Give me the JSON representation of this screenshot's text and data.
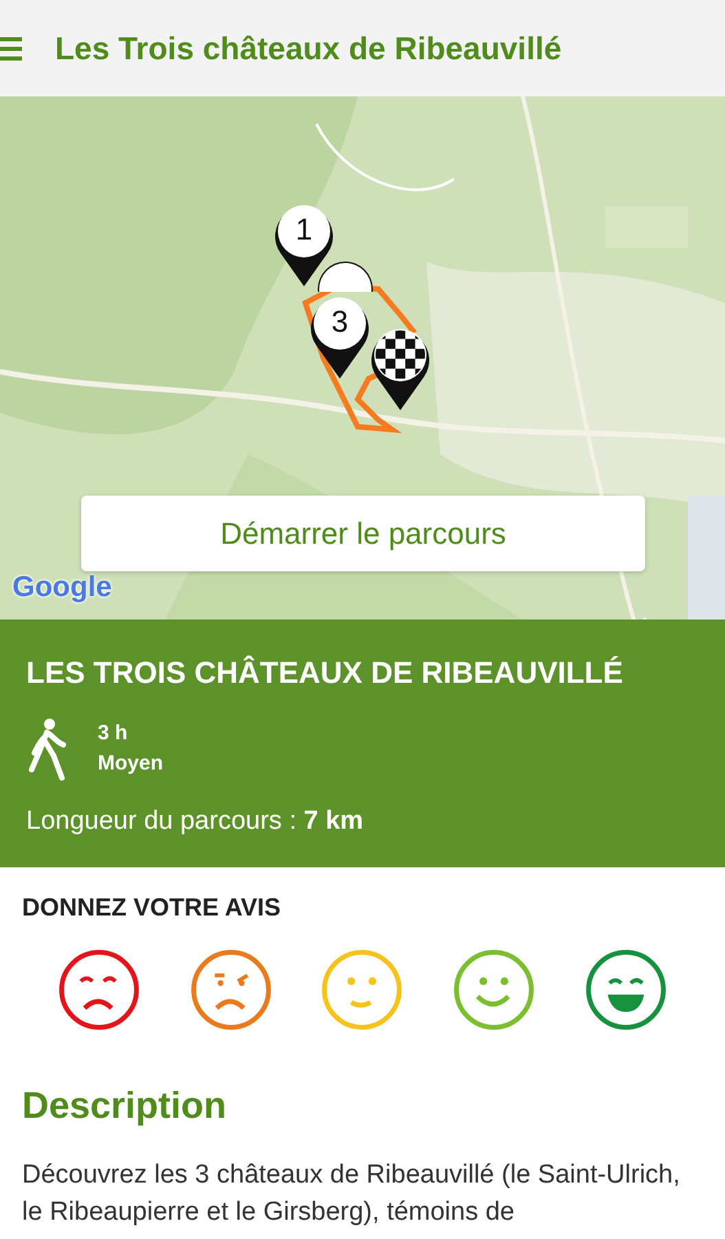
{
  "app_bar": {
    "title": "Les Trois châteaux de Ribeauvillé"
  },
  "map": {
    "kind": "picture",
    "markers": [
      {
        "kind": "number",
        "label": "1"
      },
      {
        "kind": "plain"
      },
      {
        "kind": "number",
        "label": "3"
      },
      {
        "kind": "finish"
      }
    ],
    "start_button": "Démarrer le parcours",
    "attribution": "Google"
  },
  "summary": {
    "title": "LES TROIS CHÂTEAUX DE RIBEAUVILLÉ",
    "duration": "3 h",
    "difficulty": "Moyen",
    "length": "Longueur du parcours : **7 km**"
  },
  "rating": {
    "heading": "DONNEZ VOTRE AVIS",
    "faces": [
      {
        "kind": "sad",
        "color": "#e3151b"
      },
      {
        "kind": "worried",
        "color": "#ea7a1c"
      },
      {
        "kind": "neutral",
        "color": "#f6c31b"
      },
      {
        "kind": "smile",
        "color": "#7cbf2e"
      },
      {
        "kind": "laugh",
        "color": "#16923f"
      }
    ]
  },
  "description": {
    "heading": "Description",
    "text": "Découvrez les 3 châteaux de Ribeauvillé (le Saint-Ulrich, le Ribeaupierre et le Girsberg), témoins de"
  }
}
